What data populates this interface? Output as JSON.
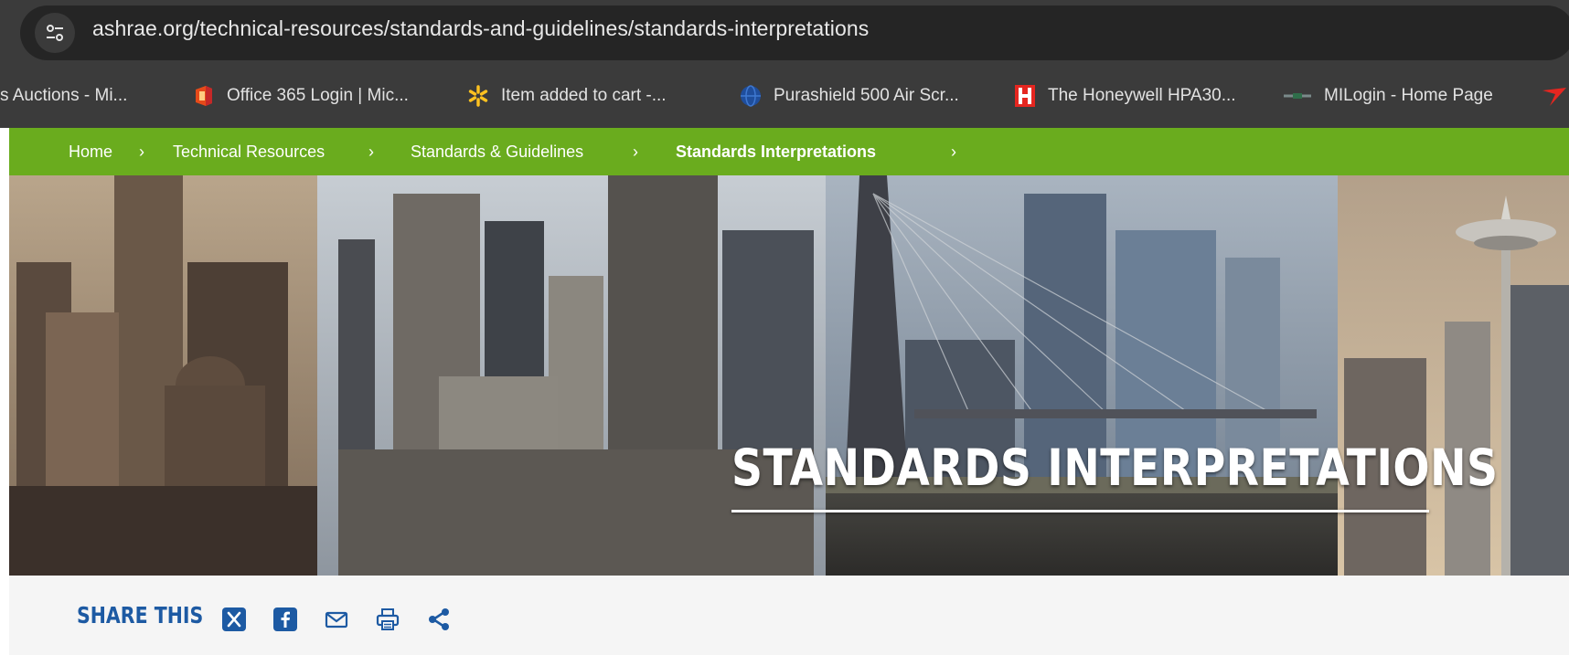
{
  "browser": {
    "url": "ashrae.org/technical-resources/standards-and-guidelines/standards-interpretations",
    "site_info_icon": "tune-icon",
    "bookmarks": [
      {
        "label": "s Auctions - Mi...",
        "icon": "none"
      },
      {
        "label": "Office 365 Login | Mic...",
        "icon": "office-icon"
      },
      {
        "label": "Item added to cart -...",
        "icon": "walmart-spark-icon"
      },
      {
        "label": "Purashield 500 Air Scr...",
        "icon": "globe-icon"
      },
      {
        "label": "The Honeywell HPA30...",
        "icon": "honeywell-h-icon"
      },
      {
        "label": "MILogin - Home Page",
        "icon": "milogin-icon"
      }
    ]
  },
  "breadcrumb": {
    "items": [
      "Home",
      "Technical Resources",
      "Standards & Guidelines",
      "Standards Interpretations"
    ],
    "separator": "›"
  },
  "hero": {
    "title": "STANDARDS INTERPRETATIONS"
  },
  "share": {
    "label": "SHARE THIS",
    "icons": [
      "x-icon",
      "facebook-icon",
      "email-icon",
      "print-icon",
      "share-icon"
    ]
  },
  "colors": {
    "breadcrumb_bg": "#6aac1e",
    "brand_blue": "#1d5aa3",
    "chrome_bg": "#3b3b3b"
  }
}
